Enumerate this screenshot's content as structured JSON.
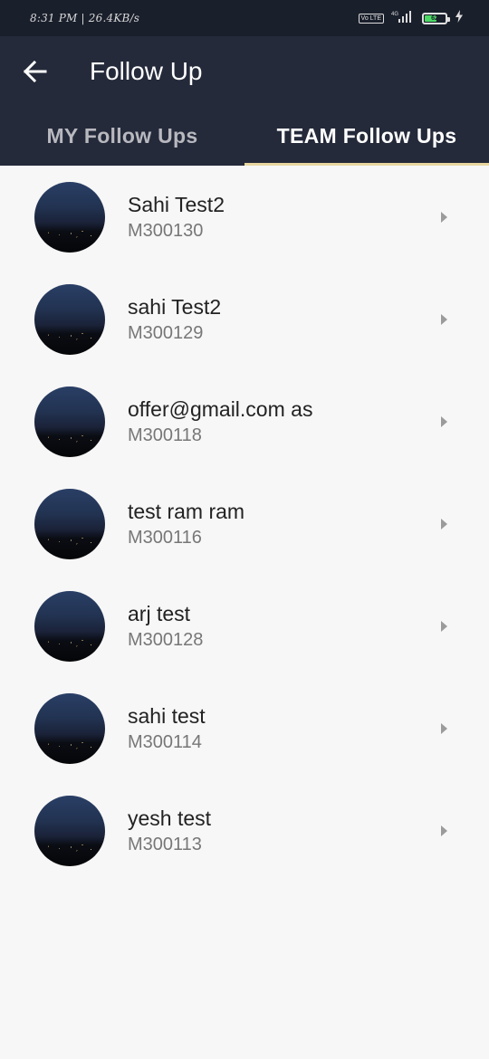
{
  "status_bar": {
    "time_text": "8:31 PM | 26.4KB/s",
    "volte": "Vo LTE",
    "network": "4G",
    "battery_level": "62",
    "battery_fraction": 0.62
  },
  "app_bar": {
    "title": "Follow Up",
    "back_icon": "arrow-left-icon"
  },
  "tabs": [
    {
      "label": "MY Follow Ups",
      "active": false
    },
    {
      "label": "TEAM Follow Ups",
      "active": true
    }
  ],
  "colors": {
    "app_bar": "#242a3a",
    "status_bar": "#1a1f2c",
    "tab_indicator": "#e8d7a0",
    "background": "#f7f7f7"
  },
  "items": [
    {
      "name": "Sahi Test2",
      "code": "M300130"
    },
    {
      "name": "sahi Test2",
      "code": "M300129"
    },
    {
      "name": "offer@gmail.com as",
      "code": "M300118"
    },
    {
      "name": "test ram ram",
      "code": "M300116"
    },
    {
      "name": "arj test",
      "code": "M300128"
    },
    {
      "name": "sahi test",
      "code": "M300114"
    },
    {
      "name": "yesh test",
      "code": "M300113"
    }
  ]
}
